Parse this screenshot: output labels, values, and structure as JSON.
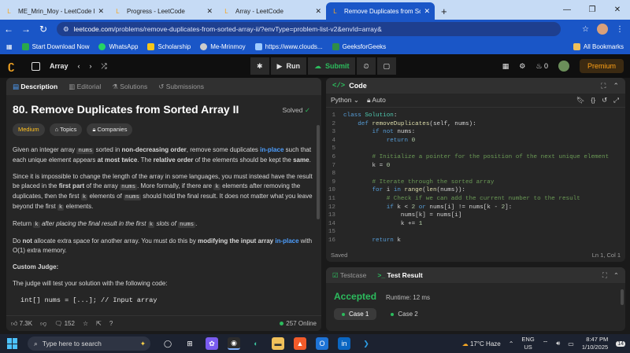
{
  "browser": {
    "tabs": [
      {
        "title": "ME_Mrin_Moy - LeetCode Profi",
        "active": false,
        "fav": "L",
        "fav_color": "#f5a623"
      },
      {
        "title": "Progress - LeetCode",
        "active": false,
        "fav": "L",
        "fav_color": "#f5a623"
      },
      {
        "title": "Array - LeetCode",
        "active": false,
        "fav": "L",
        "fav_color": "#f5a623"
      },
      {
        "title": "Remove Duplicates from Sorted",
        "active": true,
        "fav": "L",
        "fav_color": "#f5a623"
      }
    ],
    "new_tab": "+",
    "url_host": "leetcode.com",
    "url_path": "/problems/remove-duplicates-from-sorted-array-ii/?envType=problem-list-v2&envId=array&",
    "bookmarks": [
      {
        "label": "Start Download Now",
        "color": "#2aa84a"
      },
      {
        "label": "WhatsApp",
        "color": "#25d366"
      },
      {
        "label": "Scholarship",
        "color": "#f5c518"
      },
      {
        "label": "Me-Mrinmoy",
        "color": "#cccccc"
      },
      {
        "label": "https://www.clouds...",
        "color": "#9ecbff"
      },
      {
        "label": "GeeksforGeeks",
        "color": "#2f8d46"
      }
    ],
    "all_bookmarks": "All Bookmarks"
  },
  "leetcode": {
    "nav_label": "Array",
    "run": "Run",
    "submit": "Submit",
    "streak": "0",
    "premium": "Premium"
  },
  "problem": {
    "tabs": [
      "Description",
      "Editorial",
      "Solutions",
      "Submissions"
    ],
    "title": "80. Remove Duplicates from Sorted Array II",
    "solved": "Solved",
    "chips": [
      "Medium",
      "Topics",
      "Companies"
    ],
    "custom_judge": "Custom Judge:",
    "judge_intro": "The judge will test your solution with the following code:",
    "code_line": "int[] nums = [...]; // Input array",
    "likes": "7.3K",
    "comments": "152",
    "online": "257 Online"
  },
  "code": {
    "header": "Code",
    "language": "Python",
    "auto": "Auto",
    "saved": "Saved",
    "cursor": "Ln 1, Col 1"
  },
  "result": {
    "tab_testcase": "Testcase",
    "tab_result": "Test Result",
    "status": "Accepted",
    "runtime": "Runtime: 12 ms",
    "cases": [
      "Case 1",
      "Case 2"
    ]
  },
  "taskbar": {
    "search": "Type here to search",
    "weather": "17°C  Haze",
    "lang_top": "ENG",
    "lang_bot": "US",
    "time": "8:47 PM",
    "date": "1/10/2025",
    "notif": "14"
  }
}
